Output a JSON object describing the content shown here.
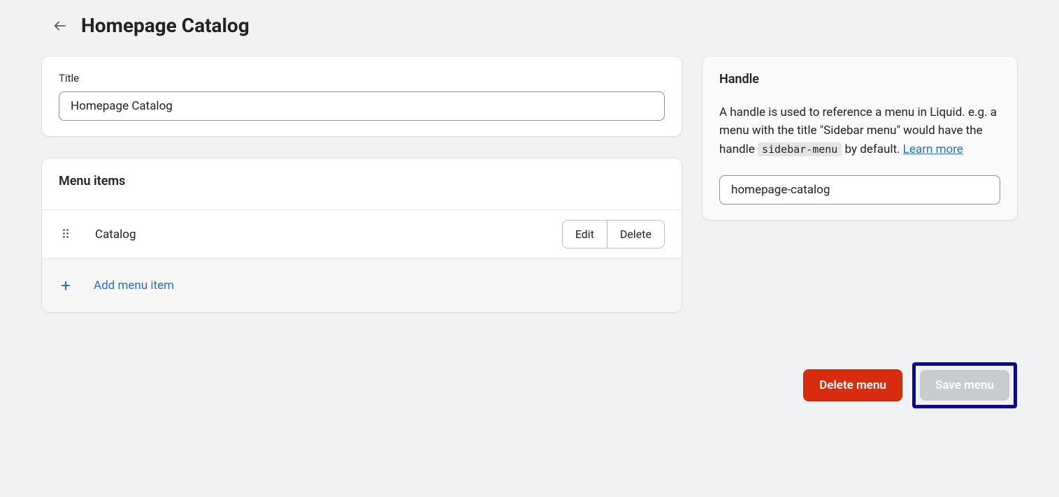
{
  "page_title": "Homepage Catalog",
  "title_field": {
    "label": "Title",
    "value": "Homepage Catalog"
  },
  "menu_items_section": {
    "heading": "Menu items",
    "items": [
      {
        "label": "Catalog",
        "edit_label": "Edit",
        "delete_label": "Delete"
      }
    ],
    "add_label": "Add menu item"
  },
  "handle_panel": {
    "heading": "Handle",
    "description_pre": "A handle is used to reference a menu in Liquid. e.g. a menu with the title \"Sidebar menu\" would have the handle ",
    "description_code": "sidebar-menu",
    "description_post": " by default. ",
    "learn_more": "Learn more",
    "value": "homepage-catalog"
  },
  "footer": {
    "delete_label": "Delete menu",
    "save_label": "Save menu"
  }
}
